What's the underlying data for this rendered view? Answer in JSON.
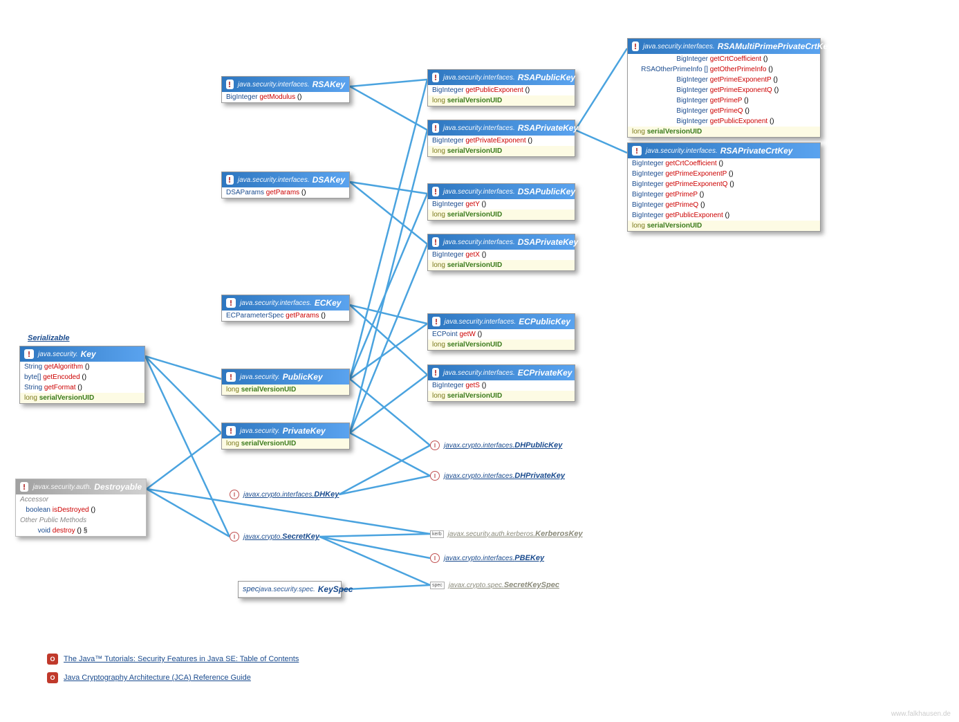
{
  "ext_label": "Serializable",
  "watermark": "www.falkhausen.de",
  "refs": [
    {
      "text": "The Java™ Tutorials: Security Features in Java SE: Table of Contents"
    },
    {
      "text": "Java Cryptography Architecture (JCA) Reference Guide"
    }
  ],
  "boxes": {
    "key": {
      "pkg": "java.security.",
      "cls": "Key",
      "methods": [
        {
          "ret": "String",
          "name": "getAlgorithm"
        },
        {
          "ret": "byte[]",
          "name": "getEncoded"
        },
        {
          "ret": "String",
          "name": "getFormat"
        }
      ],
      "fields": [
        {
          "type": "long",
          "name": "serialVersionUID"
        }
      ]
    },
    "destroyable": {
      "pkg": "javax.security.auth.",
      "cls": "Destroyable",
      "sections": [
        {
          "heading": "Accessor"
        },
        {
          "method": {
            "ret": "boolean",
            "name": "isDestroyed"
          }
        },
        {
          "heading": "Other Public Methods"
        },
        {
          "method": {
            "ret": "void",
            "name": "destroy",
            "suffix": " §"
          }
        }
      ]
    },
    "rsakey": {
      "pkg": "java.security.interfaces.",
      "cls": "RSAKey",
      "methods": [
        {
          "ret": "BigInteger",
          "name": "getModulus"
        }
      ]
    },
    "dsakey": {
      "pkg": "java.security.interfaces.",
      "cls": "DSAKey",
      "methods": [
        {
          "ret": "DSAParams",
          "name": "getParams"
        }
      ]
    },
    "eckey": {
      "pkg": "java.security.interfaces.",
      "cls": "ECKey",
      "methods": [
        {
          "ret": "ECParameterSpec",
          "name": "getParams"
        }
      ]
    },
    "publickey": {
      "pkg": "java.security.",
      "cls": "PublicKey",
      "fields": [
        {
          "type": "long",
          "name": "serialVersionUID"
        }
      ]
    },
    "privatekey": {
      "pkg": "java.security.",
      "cls": "PrivateKey",
      "fields": [
        {
          "type": "long",
          "name": "serialVersionUID"
        }
      ]
    },
    "rsapublickey": {
      "pkg": "java.security.interfaces.",
      "cls": "RSAPublicKey",
      "methods": [
        {
          "ret": "BigInteger",
          "name": "getPublicExponent"
        }
      ],
      "fields": [
        {
          "type": "long",
          "name": "serialVersionUID"
        }
      ]
    },
    "rsaprivatekey": {
      "pkg": "java.security.interfaces.",
      "cls": "RSAPrivateKey",
      "methods": [
        {
          "ret": "BigInteger",
          "name": "getPrivateExponent"
        }
      ],
      "fields": [
        {
          "type": "long",
          "name": "serialVersionUID"
        }
      ]
    },
    "dsapublickey": {
      "pkg": "java.security.interfaces.",
      "cls": "DSAPublicKey",
      "methods": [
        {
          "ret": "BigInteger",
          "name": "getY"
        }
      ],
      "fields": [
        {
          "type": "long",
          "name": "serialVersionUID"
        }
      ]
    },
    "dsaprivatekey": {
      "pkg": "java.security.interfaces.",
      "cls": "DSAPrivateKey",
      "methods": [
        {
          "ret": "BigInteger",
          "name": "getX"
        }
      ],
      "fields": [
        {
          "type": "long",
          "name": "serialVersionUID"
        }
      ]
    },
    "ecpublickey": {
      "pkg": "java.security.interfaces.",
      "cls": "ECPublicKey",
      "methods": [
        {
          "ret": "ECPoint",
          "name": "getW"
        }
      ],
      "fields": [
        {
          "type": "long",
          "name": "serialVersionUID"
        }
      ]
    },
    "ecprivatekey": {
      "pkg": "java.security.interfaces.",
      "cls": "ECPrivateKey",
      "methods": [
        {
          "ret": "BigInteger",
          "name": "getS"
        }
      ],
      "fields": [
        {
          "type": "long",
          "name": "serialVersionUID"
        }
      ]
    },
    "rsamultiprime": {
      "pkg": "java.security.interfaces.",
      "cls": "RSAMultiPrimePrivateCrtKey",
      "methods": [
        {
          "ret": "BigInteger",
          "name": "getCrtCoefficient"
        },
        {
          "ret": "RSAOtherPrimeInfo []",
          "name": "getOtherPrimeInfo"
        },
        {
          "ret": "BigInteger",
          "name": "getPrimeExponentP"
        },
        {
          "ret": "BigInteger",
          "name": "getPrimeExponentQ"
        },
        {
          "ret": "BigInteger",
          "name": "getPrimeP"
        },
        {
          "ret": "BigInteger",
          "name": "getPrimeQ"
        },
        {
          "ret": "BigInteger",
          "name": "getPublicExponent"
        }
      ],
      "fields": [
        {
          "type": "long",
          "name": "serialVersionUID"
        }
      ]
    },
    "rsaprivatecrtkey": {
      "pkg": "java.security.interfaces.",
      "cls": "RSAPrivateCrtKey",
      "methods": [
        {
          "ret": "BigInteger",
          "name": "getCrtCoefficient"
        },
        {
          "ret": "BigInteger",
          "name": "getPrimeExponentP"
        },
        {
          "ret": "BigInteger",
          "name": "getPrimeExponentQ"
        },
        {
          "ret": "BigInteger",
          "name": "getPrimeP"
        },
        {
          "ret": "BigInteger",
          "name": "getPrimeQ"
        },
        {
          "ret": "BigInteger",
          "name": "getPublicExponent"
        }
      ],
      "fields": [
        {
          "type": "long",
          "name": "serialVersionUID"
        }
      ]
    },
    "keyspec": {
      "pkg": "java.security.spec.",
      "cls": "KeySpec"
    }
  },
  "minis": {
    "dhkey": {
      "pkg": "javax.crypto.interfaces.",
      "cls": "DHKey",
      "icon": "I"
    },
    "secretkey": {
      "pkg": "javax.crypto.",
      "cls": "SecretKey",
      "icon": "I"
    },
    "dhpublickey": {
      "pkg": "javax.crypto.interfaces.",
      "cls": "DHPublicKey",
      "icon": "I"
    },
    "dhprivatekey": {
      "pkg": "javax.crypto.interfaces.",
      "cls": "DHPrivateKey",
      "icon": "I"
    },
    "kerberoskey": {
      "pkg": "javax.security.auth.kerberos.",
      "cls": "KerberosKey",
      "icon": "kerb"
    },
    "pbekey": {
      "pkg": "javax.crypto.interfaces.",
      "cls": "PBEKey",
      "icon": "I"
    },
    "secretkeyspec": {
      "pkg": "javax.crypto.spec.",
      "cls": "SecretKeySpec",
      "icon": "spec"
    }
  },
  "connections": [
    [
      "key",
      "publickey"
    ],
    [
      "key",
      "privatekey"
    ],
    [
      "key",
      "secretkey"
    ],
    [
      "destroyable",
      "privatekey"
    ],
    [
      "destroyable",
      "secretkey"
    ],
    [
      "destroyable",
      "kerberoskey"
    ],
    [
      "rsakey",
      "rsapublickey"
    ],
    [
      "rsakey",
      "rsaprivatekey"
    ],
    [
      "dsakey",
      "dsapublickey"
    ],
    [
      "dsakey",
      "dsaprivatekey"
    ],
    [
      "eckey",
      "ecpublickey"
    ],
    [
      "eckey",
      "ecprivatekey"
    ],
    [
      "publickey",
      "rsapublickey"
    ],
    [
      "publickey",
      "dsapublickey"
    ],
    [
      "publickey",
      "ecpublickey"
    ],
    [
      "publickey",
      "dhpublickey"
    ],
    [
      "privatekey",
      "rsaprivatekey"
    ],
    [
      "privatekey",
      "dsaprivatekey"
    ],
    [
      "privatekey",
      "ecprivatekey"
    ],
    [
      "privatekey",
      "dhprivatekey"
    ],
    [
      "rsaprivatekey",
      "rsamultiprime"
    ],
    [
      "rsaprivatekey",
      "rsaprivatecrtkey"
    ],
    [
      "dhkey",
      "dhpublickey"
    ],
    [
      "dhkey",
      "dhprivatekey"
    ],
    [
      "secretkey",
      "kerberoskey"
    ],
    [
      "secretkey",
      "pbekey"
    ],
    [
      "secretkey",
      "secretkeyspec"
    ],
    [
      "keyspec",
      "secretkeyspec"
    ]
  ]
}
